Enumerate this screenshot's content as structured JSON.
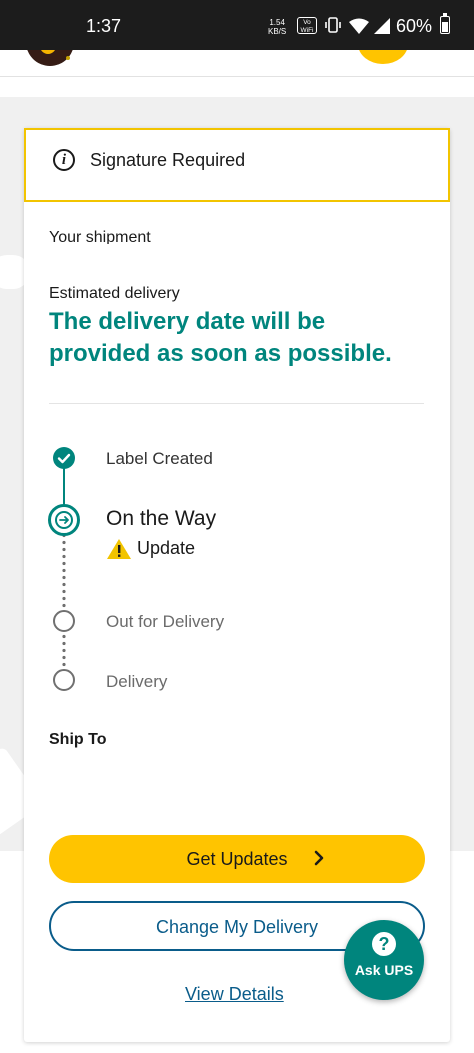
{
  "status_bar": {
    "time": "1:37",
    "net_rate_value": "1.54",
    "net_rate_unit": "KB/S",
    "vowifi_top": "Vo",
    "vowifi_bottom": "WiFi",
    "battery": "60%"
  },
  "alert": {
    "text": "Signature Required",
    "border_color": "#f2c400"
  },
  "shipment": {
    "heading": "Your shipment",
    "estimated_label": "Estimated delivery",
    "estimated_message": "The delivery date will be provided as soon as possible."
  },
  "progress": {
    "steps": [
      {
        "label": "Label Created",
        "state": "complete"
      },
      {
        "label": "On the Way",
        "state": "current",
        "note": "Update"
      },
      {
        "label": "Out for Delivery",
        "state": "pending"
      },
      {
        "label": "Delivery",
        "state": "pending"
      }
    ]
  },
  "ship_to": {
    "label": "Ship To"
  },
  "actions": {
    "get_updates": "Get Updates",
    "change_delivery": "Change My Delivery",
    "view_details": "View Details"
  },
  "chat": {
    "label": "Ask UPS"
  },
  "colors": {
    "accent": "#00857d",
    "primary_button": "#ffc400",
    "link": "#0a5c8a"
  }
}
